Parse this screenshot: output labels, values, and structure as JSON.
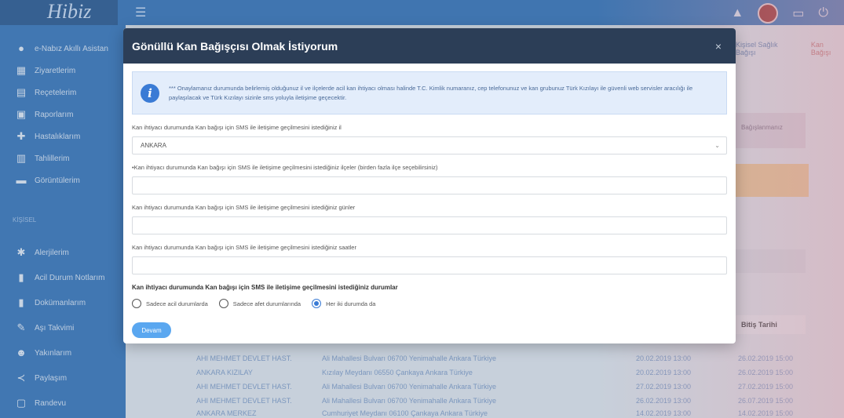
{
  "app": {
    "logo_text": "Hibiz"
  },
  "header": {
    "menu_icon": "menu-icon"
  },
  "sidebar": {
    "items": [
      {
        "label": "e-Nabız Akıllı Asistan",
        "icon": "person-icon"
      },
      {
        "label": "Ziyaretlerim",
        "icon": "hospital-icon"
      },
      {
        "label": "Reçetelerim",
        "icon": "prescription-icon"
      },
      {
        "label": "Raporlarım",
        "icon": "report-icon"
      },
      {
        "label": "Hastalıklarım",
        "icon": "disease-icon"
      },
      {
        "label": "Tahlillerim",
        "icon": "lab-icon"
      },
      {
        "label": "Görüntülerim",
        "icon": "image-icon"
      }
    ],
    "section_label": "KİŞİSEL",
    "items2": [
      {
        "label": "Alerjilerim",
        "icon": "allergy-icon"
      },
      {
        "label": "Acil Durum Notlarım",
        "icon": "note-icon"
      },
      {
        "label": "Dokümanlarım",
        "icon": "document-icon"
      },
      {
        "label": "Aşı Takvimi",
        "icon": "vaccine-icon"
      },
      {
        "label": "Yakınlarım",
        "icon": "people-icon"
      },
      {
        "label": "Paylaşım",
        "icon": "share-icon"
      },
      {
        "label": "Randevu",
        "icon": "calendar-icon"
      }
    ]
  },
  "background": {
    "breadcrumb": [
      "Kişisel Sağlık Bağışı",
      "Kan Bağışı"
    ],
    "card_text": "Bağışlanmanız",
    "table_head": "Bitiş Tarihi",
    "rows": [
      {
        "c1": "AHI MEHMET DEVLET HAST.",
        "c2": "Ali Mahallesi Bulvarı 06700 Yenimahalle Ankara Türkiye",
        "c3": "20.02.2019 13:00",
        "c4": "26.02.2019 15:00"
      },
      {
        "c1": "ANKARA KIZILAY",
        "c2": "Kızılay Meydanı 06550 Çankaya Ankara Türkiye",
        "c3": "20.02.2019 13:00",
        "c4": "26.02.2019 15:00"
      },
      {
        "c1": "AHI MEHMET DEVLET HAST.",
        "c2": "Ali Mahallesi Bulvarı 06700 Yenimahalle Ankara Türkiye",
        "c3": "27.02.2019 13:00",
        "c4": "27.02.2019 15:00"
      },
      {
        "c1": "AHI MEHMET DEVLET HAST.",
        "c2": "Ali Mahallesi Bulvarı 06700 Yenimahalle Ankara Türkiye",
        "c3": "26.02.2019 13:00",
        "c4": "26.07.2019 15:00"
      },
      {
        "c1": "ANKARA MERKEZ",
        "c2": "Cumhuriyet Meydanı 06100 Çankaya Ankara Türkiye",
        "c3": "14.02.2019 13:00",
        "c4": "14.02.2019 15:00"
      }
    ]
  },
  "modal": {
    "title": "Gönüllü Kan Bağışçısı Olmak İstiyorum",
    "close_label": "×",
    "info_text": "*** Onaylamanız durumunda belirlemiş olduğunuz il ve ilçelerde acil kan ihtiyacı olması halinde T.C. Kimlik numaranız, cep telefonunuz ve kan grubunuz Türk Kızılayı ile güvenli web servisler aracılığı ile paylaşılacak ve Türk Kızılayı sizinle sms yoluyla iletişime geçecektir.",
    "fields": [
      {
        "label": "Kan ihtiyacı durumunda Kan bağışı için SMS ile iletişime geçilmesini istediğiniz il",
        "value": "ANKARA"
      },
      {
        "label": "•Kan ihtiyacı durumunda Kan bağışı için SMS ile iletişime geçilmesini istediğiniz ilçeler (birden fazla ilçe seçebilirsiniz)",
        "value": ""
      },
      {
        "label": "Kan ihtiyacı durumunda Kan bağışı için SMS ile iletişime geçilmesini istediğiniz günler",
        "value": ""
      },
      {
        "label": "Kan ihtiyacı durumunda Kan bağışı için SMS ile iletişime geçilmesini istediğiniz saatler",
        "value": ""
      }
    ],
    "radio_title": "Kan ihtiyacı durumunda Kan bağışı için SMS ile iletişime geçilmesini istediğiniz durumlar",
    "radio_options": [
      "Sadece acil durumlarda",
      "Sadece afet durumlarında",
      "Her iki durumda da"
    ],
    "radio_selected": 2,
    "save_label": "Devam"
  },
  "colors": {
    "header": "#2c3e57",
    "sidebar": "#2d6fb8",
    "accent": "#3a7bd5",
    "info_bg": "#e3edfb"
  }
}
